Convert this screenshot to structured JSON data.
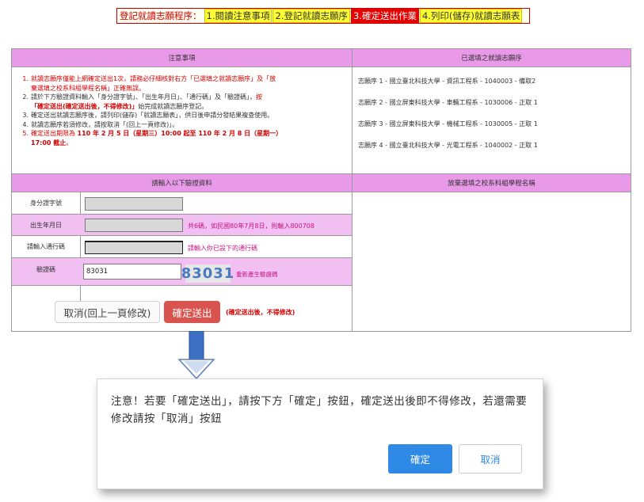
{
  "steps_bar": {
    "lead": "登記就讀志願程序：",
    "steps": [
      {
        "label": "1.閱讀注意事項",
        "active": false
      },
      {
        "label": "2.登記就讀志願序",
        "active": false
      },
      {
        "label": "3.確定送出作業",
        "active": true
      },
      {
        "label": "4.列印(儲存)就讀志願表",
        "active": false
      }
    ]
  },
  "notes": {
    "header": "注意事項",
    "items": [
      {
        "num": "1.",
        "lines": [
          "就讀志願序僅能上網確定送出1次，請務必仔細核對右方「已選填之就讀志願序」及「放",
          "棄選填之校系科組學程名稱」正確無誤。"
        ]
      },
      {
        "num": "2.",
        "a": "請於下方驗證資料輸入「身分證字號」、「出生年月日」、「通行碼」及「驗證碼」，",
        "b": "按",
        "c": "「確定送出(確定送出後，不得修改)」",
        "d": "始完成就讀志願序登記。"
      },
      {
        "num": "3.",
        "text": "確定送出就讀志願序後，請列印(儲存)「就讀志願表」，供日後申請分發結果複查使用。"
      },
      {
        "num": "4.",
        "text": "就讀志願序若須修改，請按取消「(回上一頁修改)」。"
      },
      {
        "num": "5.",
        "a": "確定送出期限為 ",
        "b": "110 年 2 月 5 日（星期三）10:00 起至 110 年 2 月 8 日（星期一）",
        "c": "17:00 截止",
        "d": "。"
      }
    ]
  },
  "selected": {
    "header": "已選填之就讀志願序",
    "items": [
      "志願序 1 - 國立臺北科技大學 - 資訊工程系 - 1040003 - 備取2",
      "志願序 2 - 國立屏東科技大學 - 車輛工程系 - 1030006 - 正取 1",
      "志願序 3 - 國立屏東科技大學 - 機械工程系 - 1030005 - 正取 1",
      "志願序 4 - 國立臺北科技大學 - 光電工程系 - 1040002 - 正取 1"
    ]
  },
  "verify": {
    "header": "請輸入以下驗證資料",
    "id_label": "身分證字號",
    "birth_label": "出生年月日",
    "birth_hint": "共6碼，如民國80年7月8日，則輸入800708",
    "pass_label": "請輸入通行碼",
    "pass_hint": "請輸入你已設下的通行碼",
    "captcha_label": "驗證碼",
    "captcha_value": "83031",
    "captcha_image_text": "83031",
    "captcha_refresh": "重新產生驗證碼",
    "cancel_button": "取消(回上一頁修改)",
    "submit_button": "確定送出",
    "submit_note": "(確定送出後，不得修改)"
  },
  "abandoned": {
    "header": "放棄選填之校系科組學程名稱"
  },
  "dialog": {
    "message": "注意！若要「確定送出」，請按下方「確定」按鈕，確定送出後即不得修改，若還需要修改請按「取消」按鈕",
    "ok_button": "確定",
    "cancel_button": "取消"
  },
  "colors": {
    "header_bg": "#e89ae8",
    "row_pink": "#f2bff2",
    "submit_red": "#d9534f",
    "dialog_blue": "#2f8ae6",
    "arrow_blue": "#3a6fc4"
  }
}
